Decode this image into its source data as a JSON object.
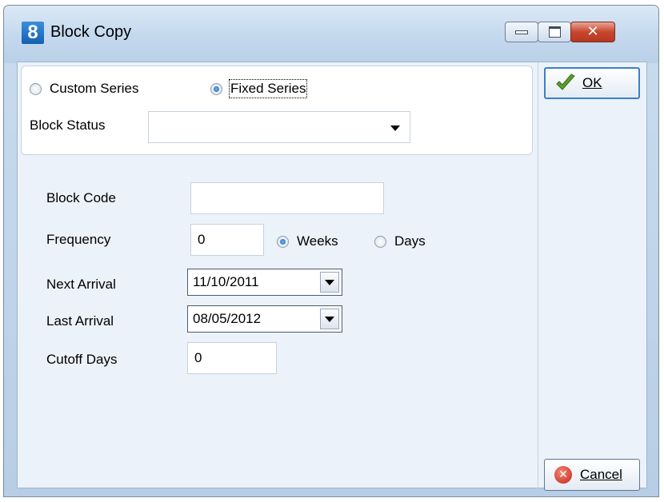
{
  "window": {
    "app_icon_glyph": "8",
    "title": "Block Copy",
    "controls": {
      "close_glyph": "✕"
    }
  },
  "series": {
    "custom_label": "Custom Series",
    "fixed_label": "Fixed Series",
    "selected": "fixed"
  },
  "block_status": {
    "label": "Block Status",
    "value": ""
  },
  "form": {
    "block_code": {
      "label": "Block Code",
      "value": ""
    },
    "frequency": {
      "label": "Frequency",
      "value": "0",
      "weeks_label": "Weeks",
      "days_label": "Days",
      "selected": "weeks"
    },
    "next_arrival": {
      "label": "Next Arrival",
      "value": "11/10/2011"
    },
    "last_arrival": {
      "label": "Last Arrival",
      "value": "08/05/2012"
    },
    "cutoff_days": {
      "label": "Cutoff Days",
      "value": "0"
    }
  },
  "buttons": {
    "ok_label": "OK",
    "cancel_label": "Cancel"
  },
  "colors": {
    "accent": "#3c7fc8",
    "close": "#c8462d",
    "ok_check": "#5aa02c",
    "cancel_icon": "#c81e0d"
  },
  "icons": {
    "ok": "check-icon",
    "cancel": "cancel-icon"
  }
}
